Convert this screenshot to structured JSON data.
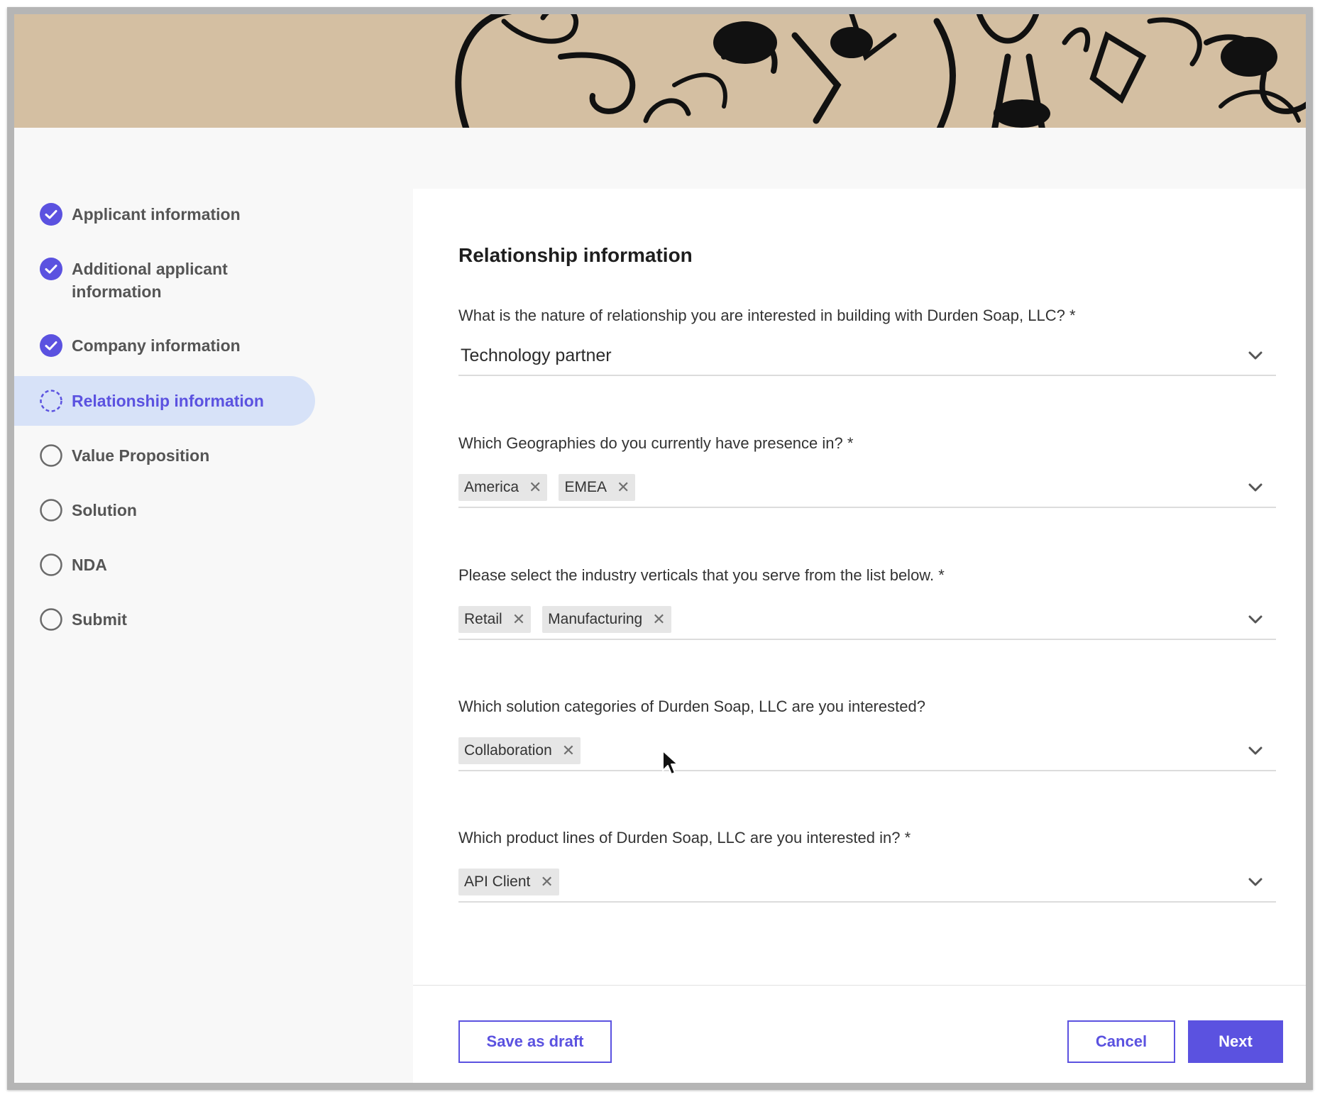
{
  "theme": {
    "accent": "#5b52e0",
    "active_bg": "#d7e2f8",
    "banner_bg": "#d4bfa2"
  },
  "steps": [
    {
      "label": "Applicant information",
      "status": "complete",
      "icon": "check-circle-icon"
    },
    {
      "label": "Additional applicant information",
      "status": "complete",
      "icon": "check-circle-icon"
    },
    {
      "label": "Company information",
      "status": "complete",
      "icon": "check-circle-icon"
    },
    {
      "label": "Relationship information",
      "status": "in-progress",
      "icon": "dashed-circle-icon"
    },
    {
      "label": "Value Proposition",
      "status": "pending",
      "icon": "empty-circle-icon"
    },
    {
      "label": "Solution",
      "status": "pending",
      "icon": "empty-circle-icon"
    },
    {
      "label": "NDA",
      "status": "pending",
      "icon": "empty-circle-icon"
    },
    {
      "label": "Submit",
      "status": "pending",
      "icon": "empty-circle-icon"
    }
  ],
  "form": {
    "title": "Relationship information",
    "relationship": {
      "label": "What is the nature of relationship you are interested in building with Durden Soap, LLC? *",
      "value": "Technology partner"
    },
    "geographies": {
      "label": "Which Geographies do you currently have presence in? *",
      "chips": [
        "America",
        "EMEA"
      ]
    },
    "verticals": {
      "label": "Please select the industry verticals that you serve from the list below. *",
      "chips": [
        "Retail",
        "Manufacturing"
      ]
    },
    "solutions": {
      "label": "Which solution categories of Durden Soap, LLC are you interested?",
      "chips": [
        "Collaboration"
      ]
    },
    "products": {
      "label": "Which product lines of Durden Soap, LLC are you interested in? *",
      "chips": [
        "API Client"
      ]
    }
  },
  "footer": {
    "save_label": "Save as draft",
    "cancel_label": "Cancel",
    "next_label": "Next"
  },
  "chip_remove_glyph": "✕"
}
